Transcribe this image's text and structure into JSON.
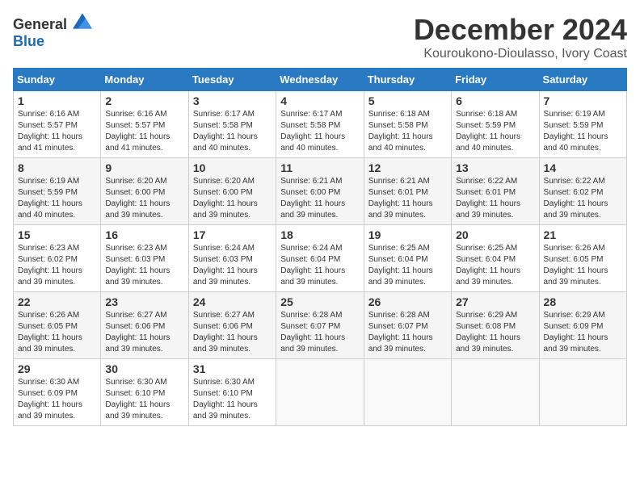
{
  "header": {
    "logo_general": "General",
    "logo_blue": "Blue",
    "title": "December 2024",
    "location": "Kouroukono-Dioulasso, Ivory Coast"
  },
  "calendar": {
    "days_of_week": [
      "Sunday",
      "Monday",
      "Tuesday",
      "Wednesday",
      "Thursday",
      "Friday",
      "Saturday"
    ],
    "weeks": [
      [
        {
          "day": "1",
          "sunrise": "6:16 AM",
          "sunset": "5:57 PM",
          "daylight": "11 hours and 41 minutes."
        },
        {
          "day": "2",
          "sunrise": "6:16 AM",
          "sunset": "5:57 PM",
          "daylight": "11 hours and 41 minutes."
        },
        {
          "day": "3",
          "sunrise": "6:17 AM",
          "sunset": "5:58 PM",
          "daylight": "11 hours and 40 minutes."
        },
        {
          "day": "4",
          "sunrise": "6:17 AM",
          "sunset": "5:58 PM",
          "daylight": "11 hours and 40 minutes."
        },
        {
          "day": "5",
          "sunrise": "6:18 AM",
          "sunset": "5:58 PM",
          "daylight": "11 hours and 40 minutes."
        },
        {
          "day": "6",
          "sunrise": "6:18 AM",
          "sunset": "5:59 PM",
          "daylight": "11 hours and 40 minutes."
        },
        {
          "day": "7",
          "sunrise": "6:19 AM",
          "sunset": "5:59 PM",
          "daylight": "11 hours and 40 minutes."
        }
      ],
      [
        {
          "day": "8",
          "sunrise": "6:19 AM",
          "sunset": "5:59 PM",
          "daylight": "11 hours and 40 minutes."
        },
        {
          "day": "9",
          "sunrise": "6:20 AM",
          "sunset": "6:00 PM",
          "daylight": "11 hours and 39 minutes."
        },
        {
          "day": "10",
          "sunrise": "6:20 AM",
          "sunset": "6:00 PM",
          "daylight": "11 hours and 39 minutes."
        },
        {
          "day": "11",
          "sunrise": "6:21 AM",
          "sunset": "6:00 PM",
          "daylight": "11 hours and 39 minutes."
        },
        {
          "day": "12",
          "sunrise": "6:21 AM",
          "sunset": "6:01 PM",
          "daylight": "11 hours and 39 minutes."
        },
        {
          "day": "13",
          "sunrise": "6:22 AM",
          "sunset": "6:01 PM",
          "daylight": "11 hours and 39 minutes."
        },
        {
          "day": "14",
          "sunrise": "6:22 AM",
          "sunset": "6:02 PM",
          "daylight": "11 hours and 39 minutes."
        }
      ],
      [
        {
          "day": "15",
          "sunrise": "6:23 AM",
          "sunset": "6:02 PM",
          "daylight": "11 hours and 39 minutes."
        },
        {
          "day": "16",
          "sunrise": "6:23 AM",
          "sunset": "6:03 PM",
          "daylight": "11 hours and 39 minutes."
        },
        {
          "day": "17",
          "sunrise": "6:24 AM",
          "sunset": "6:03 PM",
          "daylight": "11 hours and 39 minutes."
        },
        {
          "day": "18",
          "sunrise": "6:24 AM",
          "sunset": "6:04 PM",
          "daylight": "11 hours and 39 minutes."
        },
        {
          "day": "19",
          "sunrise": "6:25 AM",
          "sunset": "6:04 PM",
          "daylight": "11 hours and 39 minutes."
        },
        {
          "day": "20",
          "sunrise": "6:25 AM",
          "sunset": "6:04 PM",
          "daylight": "11 hours and 39 minutes."
        },
        {
          "day": "21",
          "sunrise": "6:26 AM",
          "sunset": "6:05 PM",
          "daylight": "11 hours and 39 minutes."
        }
      ],
      [
        {
          "day": "22",
          "sunrise": "6:26 AM",
          "sunset": "6:05 PM",
          "daylight": "11 hours and 39 minutes."
        },
        {
          "day": "23",
          "sunrise": "6:27 AM",
          "sunset": "6:06 PM",
          "daylight": "11 hours and 39 minutes."
        },
        {
          "day": "24",
          "sunrise": "6:27 AM",
          "sunset": "6:06 PM",
          "daylight": "11 hours and 39 minutes."
        },
        {
          "day": "25",
          "sunrise": "6:28 AM",
          "sunset": "6:07 PM",
          "daylight": "11 hours and 39 minutes."
        },
        {
          "day": "26",
          "sunrise": "6:28 AM",
          "sunset": "6:07 PM",
          "daylight": "11 hours and 39 minutes."
        },
        {
          "day": "27",
          "sunrise": "6:29 AM",
          "sunset": "6:08 PM",
          "daylight": "11 hours and 39 minutes."
        },
        {
          "day": "28",
          "sunrise": "6:29 AM",
          "sunset": "6:09 PM",
          "daylight": "11 hours and 39 minutes."
        }
      ],
      [
        {
          "day": "29",
          "sunrise": "6:30 AM",
          "sunset": "6:09 PM",
          "daylight": "11 hours and 39 minutes."
        },
        {
          "day": "30",
          "sunrise": "6:30 AM",
          "sunset": "6:10 PM",
          "daylight": "11 hours and 39 minutes."
        },
        {
          "day": "31",
          "sunrise": "6:30 AM",
          "sunset": "6:10 PM",
          "daylight": "11 hours and 39 minutes."
        },
        null,
        null,
        null,
        null
      ]
    ]
  }
}
